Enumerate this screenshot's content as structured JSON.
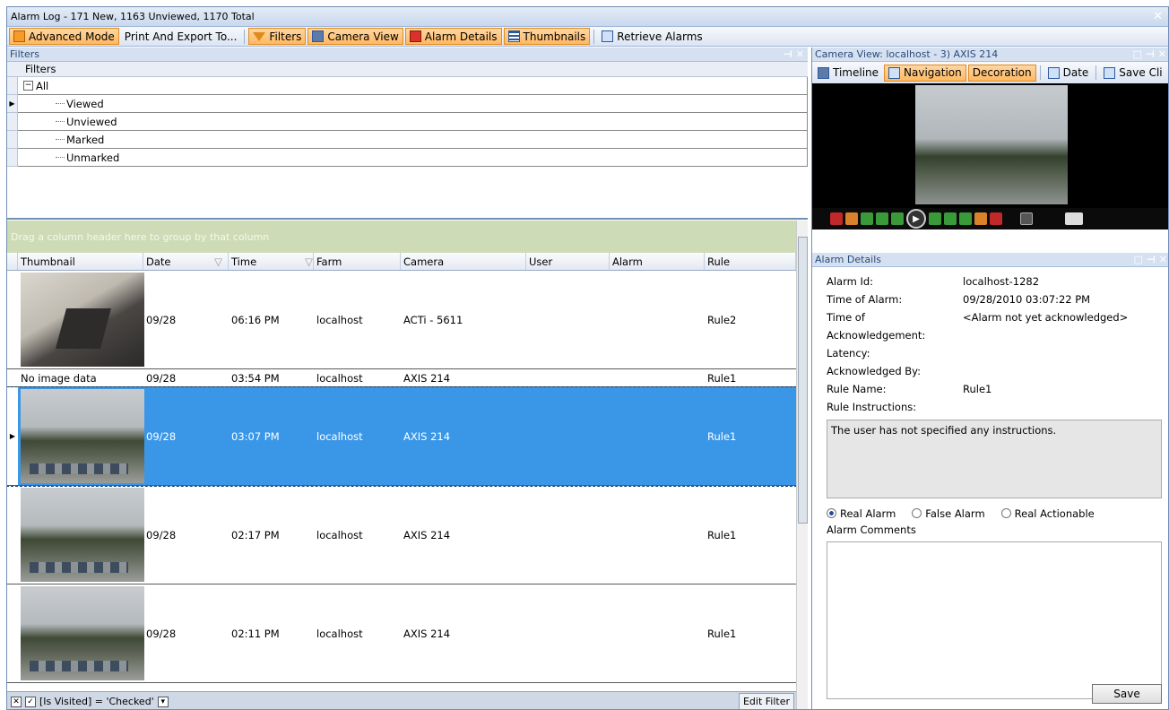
{
  "window": {
    "title": "Alarm Log - 171 New, 1163 Unviewed, 1170 Total"
  },
  "toolbar": {
    "advanced_mode": "Advanced Mode",
    "print_export": "Print And Export To...",
    "filters": "Filters",
    "camera_view": "Camera View",
    "alarm_details": "Alarm Details",
    "thumbnails": "Thumbnails",
    "retrieve_alarms": "Retrieve Alarms"
  },
  "filters_panel": {
    "title": "Filters",
    "header": "Filters",
    "root": "All",
    "items": [
      "Viewed",
      "Unviewed",
      "Marked",
      "Unmarked"
    ]
  },
  "grid": {
    "group_hint": "Drag a column header here to group by that column",
    "columns": [
      "Thumbnail",
      "Date",
      "Time",
      "Farm",
      "Camera",
      "User",
      "Alarm",
      "Rule"
    ],
    "rows": [
      {
        "thumb": "",
        "date": "09/28",
        "time": "06:16 PM",
        "farm": "localhost",
        "camera": "ACTi - 5611",
        "user": "",
        "alarm": "",
        "rule": "Rule2"
      },
      {
        "thumb": "No image data",
        "date": "09/28",
        "time": "03:54 PM",
        "farm": "localhost",
        "camera": "AXIS 214",
        "user": "",
        "alarm": "",
        "rule": "Rule1"
      },
      {
        "thumb": "",
        "date": "09/28",
        "time": "03:07 PM",
        "farm": "localhost",
        "camera": "AXIS 214",
        "user": "",
        "alarm": "",
        "rule": "Rule1"
      },
      {
        "thumb": "",
        "date": "09/28",
        "time": "02:17 PM",
        "farm": "localhost",
        "camera": "AXIS 214",
        "user": "",
        "alarm": "",
        "rule": "Rule1"
      },
      {
        "thumb": "",
        "date": "09/28",
        "time": "02:11 PM",
        "farm": "localhost",
        "camera": "AXIS 214",
        "user": "",
        "alarm": "",
        "rule": "Rule1"
      }
    ],
    "filter_expr": "[Is Visited] = 'Checked'",
    "edit_filter": "Edit Filter"
  },
  "camera_view": {
    "title": "Camera View: localhost - 3) AXIS 214",
    "timeline": "Timeline",
    "navigation": "Navigation",
    "decoration": "Decoration",
    "date": "Date",
    "save_clip": "Save Cli"
  },
  "alarm_details": {
    "title": "Alarm Details",
    "fields": [
      {
        "key": "Alarm Id:",
        "value": "localhost-1282"
      },
      {
        "key": "Time of Alarm:",
        "value": "09/28/2010 03:07:22 PM"
      },
      {
        "key": "Time of Acknowledgement:",
        "value": "<Alarm not yet acknowledged>"
      },
      {
        "key": "Latency:",
        "value": ""
      },
      {
        "key": "Acknowledged By:",
        "value": ""
      },
      {
        "key": "Rule Name:",
        "value": "Rule1"
      },
      {
        "key": "Rule Instructions:",
        "value": ""
      }
    ],
    "instructions": "The user has not specified any instructions.",
    "radio_real": "Real Alarm",
    "radio_false": "False Alarm",
    "radio_actionable": "Real Actionable",
    "comments_label": "Alarm Comments",
    "save": "Save"
  }
}
